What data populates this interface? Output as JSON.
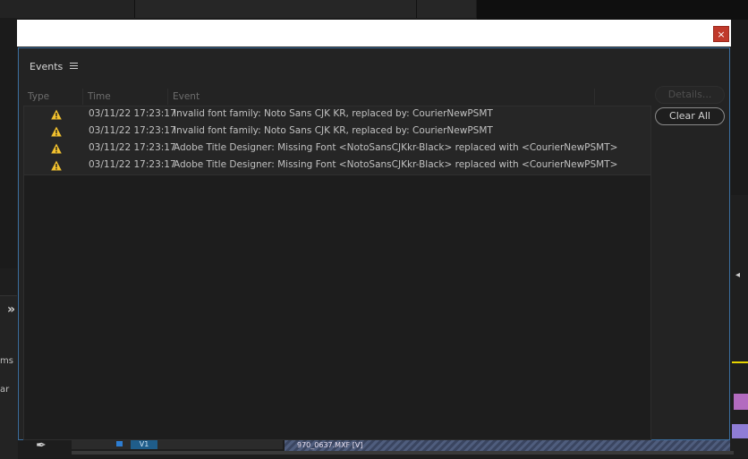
{
  "dialog": {
    "panel_title": "Events",
    "close_label": "×",
    "columns": [
      "Type",
      "Time",
      "Event"
    ],
    "details_label": "Details...",
    "clear_all_label": "Clear All",
    "rows": [
      {
        "type": "warning",
        "time": "03/11/22 17:23:17",
        "event": "Invalid font family: Noto Sans CJK KR, replaced by: CourierNewPSMT"
      },
      {
        "type": "warning",
        "time": "03/11/22 17:23:17",
        "event": "Invalid font family: Noto Sans CJK KR, replaced by: CourierNewPSMT"
      },
      {
        "type": "warning",
        "time": "03/11/22 17:23:17",
        "event": "Adobe Title Designer: Missing Font <NotoSansCJKkr-Black> replaced with <CourierNewPSMT>"
      },
      {
        "type": "warning",
        "time": "03/11/22 17:23:17",
        "event": "Adobe Title Designer: Missing Font <NotoSansCJKkr-Black> replaced with <CourierNewPSMT>"
      }
    ]
  },
  "background": {
    "left_text_1": "ms",
    "left_text_2": "ar",
    "track_label": "V1",
    "clip_label": "970_0637.MXF [V]"
  },
  "colors": {
    "accent_border": "#3b6e9e",
    "close_button": "#c0392b",
    "warning_icon": "#f2c12e"
  },
  "icons": {
    "warning": "warning-triangle-icon",
    "menu": "hamburger-menu-icon",
    "close": "close-icon"
  }
}
